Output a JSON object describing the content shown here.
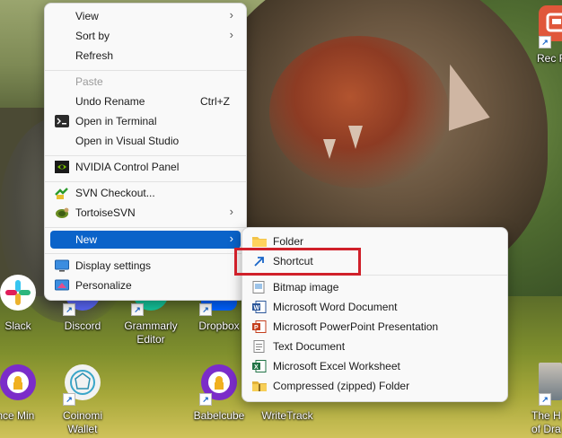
{
  "desktop": {
    "icons": [
      {
        "label": "Rec R",
        "icon": "rec-room-icon",
        "color": "#e0573a"
      },
      {
        "label": "Slack",
        "icon": "slack-icon",
        "color": "#ffffff"
      },
      {
        "label": "Discord",
        "icon": "discord-icon",
        "color": "#5865f2"
      },
      {
        "label": "Grammarly Editor",
        "icon": "grammarly-icon",
        "color": "#15c39a"
      },
      {
        "label": "Dropbox",
        "icon": "dropbox-icon",
        "color": "#0061fe"
      },
      {
        "label": "ance Min",
        "icon": "balance-miner-icon",
        "color": "#7b2cc9"
      },
      {
        "label": "Coinomi Wallet",
        "icon": "coinomi-icon",
        "color": "#f2f2f2"
      },
      {
        "label": "Babelcube",
        "icon": "babelcube-icon",
        "color": "#7b2cc9"
      },
      {
        "label": "WriteTrack",
        "icon": "writetrack-icon",
        "color": "#ffffff"
      },
      {
        "label": "The H of Dra",
        "icon": "game-icon",
        "color": "#8a9aa8"
      }
    ]
  },
  "context_menu": {
    "items": [
      {
        "label": "View",
        "submenu": true
      },
      {
        "label": "Sort by",
        "submenu": true
      },
      {
        "label": "Refresh"
      },
      {
        "label": "Paste",
        "disabled": true
      },
      {
        "label": "Undo Rename",
        "shortcut": "Ctrl+Z"
      },
      {
        "label": "Open in Terminal",
        "icon": "terminal-icon"
      },
      {
        "label": "Open in Visual Studio"
      },
      {
        "label": "NVIDIA Control Panel",
        "icon": "nvidia-icon"
      },
      {
        "label": "SVN Checkout...",
        "icon": "svn-checkout-icon"
      },
      {
        "label": "TortoiseSVN",
        "icon": "tortoisesvn-icon",
        "submenu": true
      },
      {
        "label": "New",
        "submenu": true,
        "highlighted": true
      },
      {
        "label": "Display settings",
        "icon": "display-icon"
      },
      {
        "label": "Personalize",
        "icon": "personalize-icon"
      }
    ]
  },
  "new_submenu": {
    "items": [
      {
        "label": "Folder",
        "icon": "folder-icon"
      },
      {
        "label": "Shortcut",
        "icon": "shortcut-icon",
        "annotated": true
      },
      {
        "label": "Bitmap image",
        "icon": "bitmap-icon"
      },
      {
        "label": "Microsoft Word Document",
        "icon": "word-icon"
      },
      {
        "label": "Microsoft PowerPoint Presentation",
        "icon": "powerpoint-icon"
      },
      {
        "label": "Text Document",
        "icon": "text-document-icon"
      },
      {
        "label": "Microsoft Excel Worksheet",
        "icon": "excel-icon"
      },
      {
        "label": "Compressed (zipped) Folder",
        "icon": "zip-folder-icon"
      }
    ]
  },
  "colors": {
    "highlight": "#0a63c9",
    "annotation": "#d0202a"
  }
}
